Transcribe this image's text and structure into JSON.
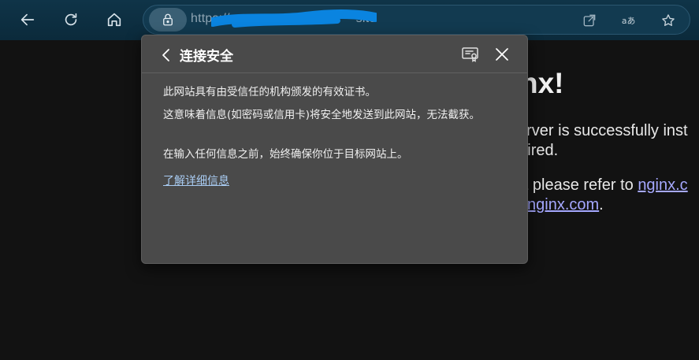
{
  "toolbar": {
    "back_icon": "arrow-left-icon",
    "refresh_icon": "refresh-icon",
    "home_icon": "home-icon"
  },
  "address_bar": {
    "lock_icon": "lock-icon",
    "url_visible_start": "https://",
    "url_visible_end": "site",
    "actions": [
      "open-in-app-icon",
      "read-aloud-icon",
      "favorite-star-icon"
    ]
  },
  "page": {
    "heading": "nx!",
    "line1": "server is successfully inst",
    "line2": "quired.",
    "line3_text": "ort please refer to ",
    "line3_link": "nginx.c",
    "line4_link": "nginx.com",
    "line4_tail": "."
  },
  "popup": {
    "title": "连接安全",
    "para1": "此网站具有由受信任的机构颁发的有效证书。",
    "para2": "这意味着信息(如密码或信用卡)将安全地发送到此网站，无法截获。",
    "para3": "在输入任何信息之前，始终确保你位于目标网站上。",
    "learn_more": "了解详细信息"
  },
  "colors": {
    "toolbar_bg": "#0f3448",
    "popup_bg": "#4a4a4a",
    "link": "#a9ccf3",
    "page_link": "#a5a8ff",
    "redaction": "#0a84e0"
  }
}
